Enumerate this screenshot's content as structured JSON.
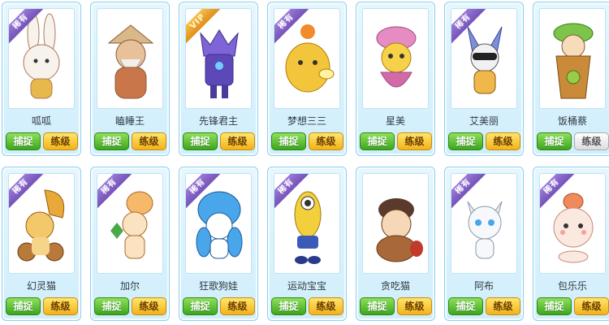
{
  "actions": {
    "catch_label": "捕捉",
    "train_label": "练级"
  },
  "badges": {
    "rare": "稀有",
    "vip": "VIP"
  },
  "pets": [
    {
      "name": "呱呱",
      "badge": "rare",
      "train_state": "active",
      "icon": "white-rabbit-icon",
      "color": "#f5f0ea"
    },
    {
      "name": "瞌睡王",
      "badge": "none",
      "train_state": "active",
      "icon": "sleepy-elder-icon",
      "color": "#d9a06a"
    },
    {
      "name": "先锋君主",
      "badge": "vip",
      "train_state": "active",
      "icon": "armored-knight-icon",
      "color": "#6a54c8"
    },
    {
      "name": "梦想三三",
      "badge": "rare",
      "train_state": "active",
      "icon": "yellow-cat-icon",
      "color": "#f3c53a"
    },
    {
      "name": "星美",
      "badge": "none",
      "train_state": "active",
      "icon": "pink-fairy-icon",
      "color": "#e78bc3"
    },
    {
      "name": "艾美丽",
      "badge": "rare",
      "train_state": "active",
      "icon": "masked-fox-icon",
      "color": "#7d8fd8"
    },
    {
      "name": "饭桶蔡",
      "badge": "none",
      "train_state": "disabled",
      "icon": "barrel-creature-icon",
      "color": "#9ccb4a"
    },
    {
      "name": "幻灵猫",
      "badge": "rare",
      "train_state": "active",
      "icon": "phantom-cat-icon",
      "color": "#f2b94a"
    },
    {
      "name": "加尔",
      "badge": "rare",
      "train_state": "active",
      "icon": "orange-bunny-icon",
      "color": "#f6b96a"
    },
    {
      "name": "狂歌狗娃",
      "badge": "rare",
      "train_state": "active",
      "icon": "blue-puppy-icon",
      "color": "#4aa6ea"
    },
    {
      "name": "运动宝宝",
      "badge": "rare",
      "train_state": "active",
      "icon": "yellow-cyclops-icon",
      "color": "#f4cf3c"
    },
    {
      "name": "贪吃猫",
      "badge": "none",
      "train_state": "active",
      "icon": "brown-glutton-icon",
      "color": "#a8683a"
    },
    {
      "name": "阿布",
      "badge": "rare",
      "train_state": "active",
      "icon": "white-kitten-icon",
      "color": "#e9eef5"
    },
    {
      "name": "包乐乐",
      "badge": "rare",
      "train_state": "active",
      "icon": "bun-creature-icon",
      "color": "#f8d2c2"
    }
  ]
}
